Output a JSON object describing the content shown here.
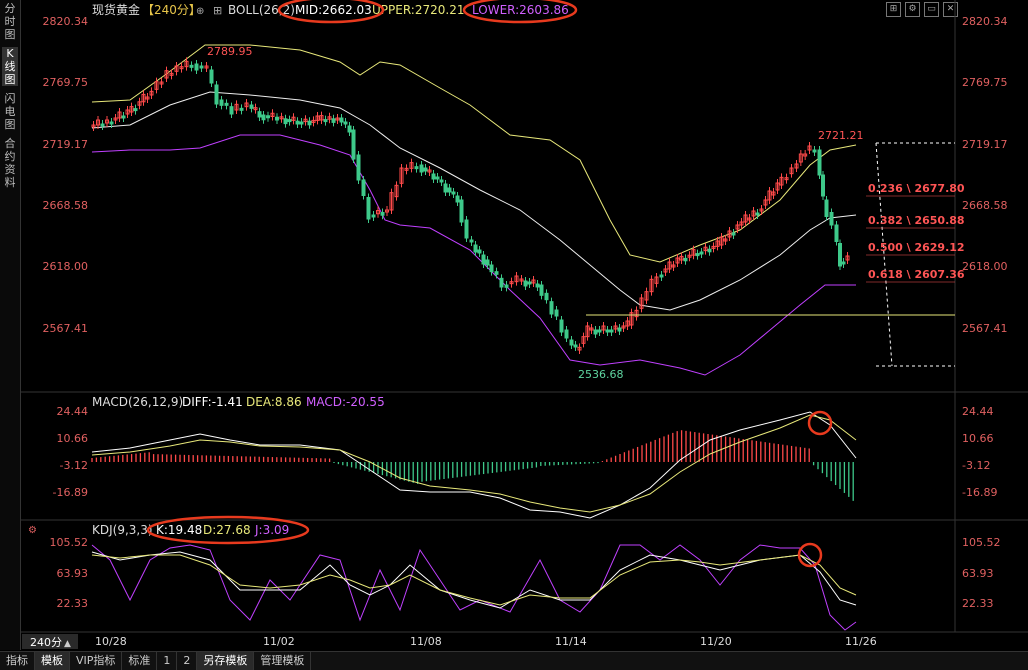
{
  "sidebar": {
    "tabs": [
      {
        "label": "分时图",
        "active": false
      },
      {
        "label": "K线图",
        "active": true
      },
      {
        "label": "闪电图",
        "active": false
      },
      {
        "label": "合约资料",
        "active": false
      }
    ]
  },
  "main_header": {
    "symbol": "现货黄金",
    "period": "【240分】",
    "boll_label": "BOLL(26,2)",
    "mid": "MID:2662.03",
    "upper": "UPPER:2720.21",
    "lower": "LOWER:2603.86"
  },
  "price_axis": {
    "ticks": [
      "2820.34",
      "2769.75",
      "2719.17",
      "2668.58",
      "2618.00",
      "2567.41"
    ]
  },
  "annotations": {
    "high": "2789.95",
    "low": "2536.68",
    "recent_high": "2721.21",
    "fib": [
      "0.236 \\ 2677.80",
      "0.382 \\ 2650.88",
      "0.500 \\ 2629.12",
      "0.618 \\ 2607.36"
    ]
  },
  "macd_header": {
    "label": "MACD(26,12,9)",
    "diff": "DIFF:-1.41",
    "dea": "DEA:8.86",
    "macd": "MACD:-20.55"
  },
  "macd_axis": {
    "ticks": [
      "24.44",
      "10.66",
      "-3.12",
      "-16.89"
    ]
  },
  "kdj_header": {
    "label": "KDJ(9,3,3)",
    "k": "K:19.48",
    "d": "D:27.68",
    "j": "J:3.09"
  },
  "kdj_axis": {
    "ticks": [
      "105.52",
      "63.93",
      "22.33"
    ]
  },
  "time_axis": {
    "period_button": "240分",
    "labels": [
      "10/28",
      "11/02",
      "11/08",
      "11/14",
      "11/20",
      "11/26"
    ]
  },
  "bottom_tabs": [
    {
      "label": "指标",
      "active": false
    },
    {
      "label": "模板",
      "active": true
    },
    {
      "label": "VIP指标",
      "active": false
    },
    {
      "label": "标准",
      "active": false
    },
    {
      "label": "1",
      "active": false
    },
    {
      "label": "2",
      "active": false
    },
    {
      "label": "另存模板",
      "active": true
    },
    {
      "label": "管理模板",
      "active": false
    }
  ],
  "colors": {
    "up": "#ff4a4a",
    "down": "#3ec98a",
    "upper_band": "#e8e87a",
    "mid_band": "#eeeeee",
    "lower_band": "#c040ff",
    "axis_text": "#e05050",
    "highlight": "#e83a1e"
  }
}
